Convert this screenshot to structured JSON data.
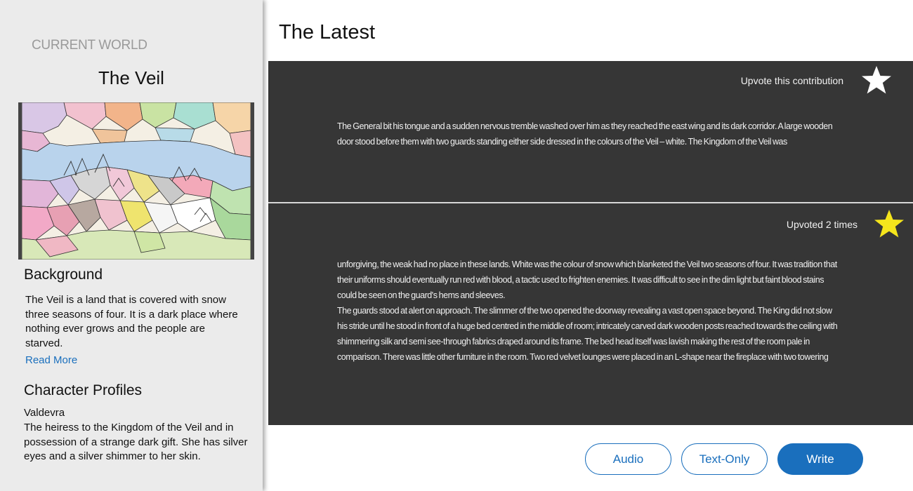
{
  "sidebar": {
    "kicker": "CURRENT WORLD",
    "world_name": "The Veil",
    "background": {
      "title": "Background",
      "text": "The Veil is a land that is covered with snow three seasons of four. It is a dark place where nothing ever grows and the people are starved.",
      "read_more": "Read More"
    },
    "characters": {
      "title": "Character Profiles",
      "items": [
        {
          "name": "Valdevra",
          "description": "The heiress to the Kingdom of the Veil and in possession of a strange dark gift. She has silver eyes and a silver shimmer to her skin."
        }
      ]
    }
  },
  "main": {
    "title": "The Latest",
    "contributions": [
      {
        "vote_label": "Upvote this contribution",
        "upvoted": false,
        "star_color": "#ffffff",
        "paragraphs": [
          "The General bit his tongue and a sudden nervous tremble washed over him as they reached the east wing and its dark corridor. A large wooden door stood before them with two guards standing either side dressed in the colours of the Veil – white. The Kingdom of the Veil was"
        ]
      },
      {
        "vote_label": "Upvoted 2 times",
        "upvoted": true,
        "star_color": "#f5e51c",
        "paragraphs": [
          "unforgiving, the weak had no place in these lands. White was the colour of snow which blanketed the Veil two seasons of four. It was tradition that their uniforms should eventually run red with blood, a tactic used to frighten enemies. It was difficult to see in the dim light but faint blood stains could be seen on the guard's hems and sleeves.",
          "The guards stood at alert on approach. The slimmer of the two opened the doorway revealing a vast open space beyond. The King did not slow his stride until he stood in front of a huge bed centred in the middle of room; intricately carved dark wooden posts reached towards the ceiling with shimmering silk and semi see-through fabrics draped around its frame. The bed head itself was lavish making the rest of the room pale in comparison. There was little other furniture in the room. Two red velvet lounges were placed in an L-shape near the fireplace with two towering"
        ]
      }
    ]
  },
  "buttons": {
    "audio": "Audio",
    "text_only": "Text-Only",
    "write": "Write"
  },
  "colors": {
    "accent": "#1a6fbd",
    "card_bg": "#363636",
    "sidebar_bg": "#ebebeb",
    "star_active": "#f5e51c",
    "star_inactive": "#ffffff"
  },
  "icons": {
    "upvote": "star-icon",
    "map": "world-map-image"
  }
}
